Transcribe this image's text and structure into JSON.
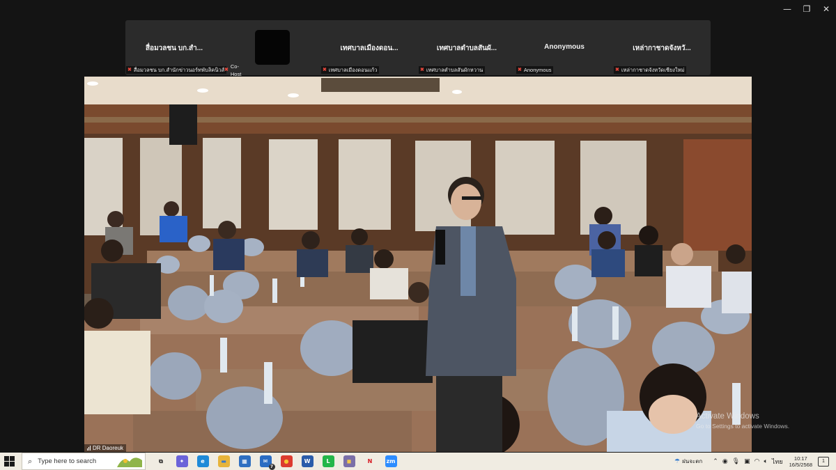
{
  "window": {
    "minimize": "—",
    "restore": "❐",
    "close": "✕"
  },
  "participants": [
    {
      "name": "สื่อมวลชน บก.สำ...",
      "label": "สื่อมวลชน บก.สำนักข่าวนอร์ทพับลิคนิวส์",
      "cohost": "Co-Host",
      "avatar": false
    },
    {
      "name": "",
      "label": "",
      "avatar": true
    },
    {
      "name": "เทศบาลเมืองดอน...",
      "label": "เทศบาลเมืองดอนแก้ว",
      "avatar": false
    },
    {
      "name": "เทศบาลตำบลสันผั...",
      "label": "เทศบาลตำบลสันผักหวาน",
      "avatar": false
    },
    {
      "name": "Anonymous",
      "label": "Anonymous",
      "avatar": false
    },
    {
      "name": "เหล่ากาชาดจังหวั...",
      "label": "เหล่ากาชาดจังหวัดเชียงใหม่",
      "avatar": false
    }
  ],
  "speaker": {
    "name": "DR Daoreuk"
  },
  "watermark": {
    "line1": "Activate Windows",
    "line2": "Go to Settings to activate Windows."
  },
  "taskbar": {
    "search_placeholder": "Type here to search",
    "apps": [
      {
        "icon": "task-view-icon",
        "glyph": "⧉",
        "color": "#f0ece2",
        "fg": "#222"
      },
      {
        "icon": "copilot-icon",
        "glyph": "✦",
        "color": "#6b63d9",
        "fg": "#fff"
      },
      {
        "icon": "edge-icon",
        "glyph": "e",
        "color": "#1f8ad8",
        "fg": "#fff"
      },
      {
        "icon": "file-explorer-icon",
        "glyph": "▬",
        "color": "#e7b43a",
        "fg": "#3a78c7"
      },
      {
        "icon": "store-icon",
        "glyph": "▦",
        "color": "#2f6fc1",
        "fg": "#fff"
      },
      {
        "icon": "mail-icon",
        "glyph": "✉",
        "color": "#2b6cc2",
        "fg": "#fff"
      },
      {
        "icon": "chrome-icon",
        "glyph": "●",
        "color": "#dc3b2f",
        "fg": "#f7c531"
      },
      {
        "icon": "word-icon",
        "glyph": "W",
        "color": "#2a5caa",
        "fg": "#fff"
      },
      {
        "icon": "line-icon",
        "glyph": "L",
        "color": "#23b64a",
        "fg": "#fff"
      },
      {
        "icon": "photo-app-icon",
        "glyph": "◼",
        "color": "#7a6fa8",
        "fg": "#f2c94c"
      },
      {
        "icon": "netflix-icon",
        "glyph": "N",
        "color": "#f0ece2",
        "fg": "#d6161f"
      },
      {
        "icon": "zoom-icon",
        "glyph": "zm",
        "color": "#2d8cff",
        "fg": "#fff"
      }
    ],
    "weather_text": "ฝนจะตก",
    "language": "ไทย",
    "time": "10:17",
    "date": "16/5/2568",
    "notification_count": "1",
    "mail_badge": "7"
  }
}
